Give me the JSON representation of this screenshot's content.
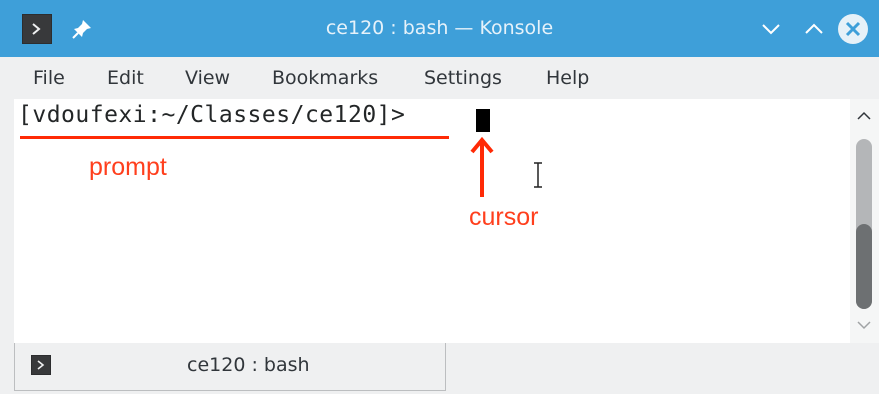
{
  "window": {
    "title": "ce120 : bash — Konsole"
  },
  "menubar": {
    "items": [
      "File",
      "Edit",
      "View",
      "Bookmarks",
      "Settings",
      "Help"
    ]
  },
  "terminal": {
    "prompt": "[vdoufexi:~/Classes/ce120]>"
  },
  "annotations": {
    "prompt_label": "prompt",
    "cursor_label": "cursor",
    "color": "#ff3f1d"
  },
  "tabs": [
    {
      "label": "ce120 : bash"
    }
  ],
  "colors": {
    "titlebar": "#3e9fd9",
    "menubar": "#eff0f1",
    "terminal_bg": "#ffffff",
    "terminal_fg": "#232627"
  },
  "icons": {
    "app": "konsole-icon",
    "pin": "pin-icon",
    "minimize": "chevron-down-icon",
    "maximize": "chevron-up-icon",
    "close": "close-icon"
  }
}
